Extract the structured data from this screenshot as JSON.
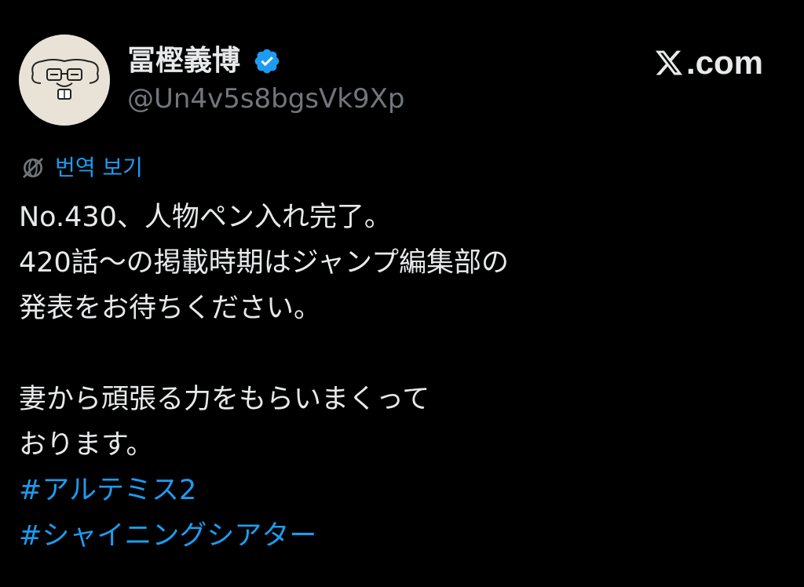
{
  "author": {
    "display_name": "冨樫義博",
    "handle": "@Un4v5s8bgsVk9Xp",
    "verified": true,
    "avatar_icon": "doodle-face-avatar"
  },
  "brand": {
    "logo_icon": "x-logo-icon",
    "domain_suffix": ".com"
  },
  "translate": {
    "icon": "globe-slash-icon",
    "label": "번역 보기"
  },
  "tweet": {
    "lines": [
      "No.430、人物ペン入れ完了。",
      "420話～の掲載時期はジャンプ編集部の",
      "発表をお待ちください。",
      "",
      "妻から頑張る力をもらいまくって",
      "おります。"
    ],
    "hashtags": [
      "#アルテミス2",
      "#シャイニングシアター"
    ]
  },
  "colors": {
    "background": "#000000",
    "text_primary": "#e7e9ea",
    "text_secondary": "#71767b",
    "accent": "#1d9bf0"
  }
}
